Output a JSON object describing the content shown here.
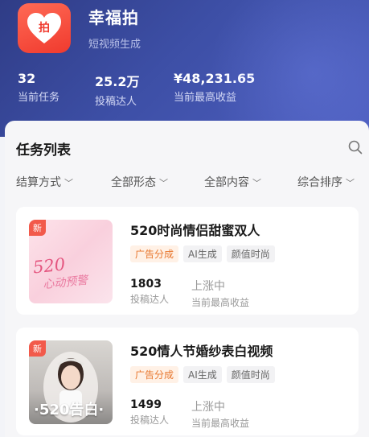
{
  "app": {
    "name": "幸福拍",
    "subtitle": "短视频生成",
    "icon": "heart-icon",
    "icon_text": "拍"
  },
  "stats": [
    {
      "value": "32",
      "label": "当前任务"
    },
    {
      "value": "25.2万",
      "label": "投稿达人"
    },
    {
      "value": "¥48,231.65",
      "label": "当前最高收益"
    }
  ],
  "task_list": {
    "title": "任务列表",
    "search_icon": "search-icon",
    "filters": [
      "结算方式",
      "全部形态",
      "全部内容",
      "综合排序"
    ]
  },
  "cards": [
    {
      "badge": "新",
      "thumb_text": "520",
      "thumb_text_sub": "心动预警",
      "title": "520时尚情侣甜蜜双人",
      "tags": [
        "广告分成",
        "AI生成",
        "颜值时尚"
      ],
      "submitters": "1803",
      "submitters_label": "投稿达人",
      "earning_status": "上涨中",
      "earning_label": "当前最高收益"
    },
    {
      "badge": "新",
      "thumb_text": "·520告白·",
      "title": "520情人节婚纱表白视频",
      "tags": [
        "广告分成",
        "AI生成",
        "颜值时尚"
      ],
      "submitters": "1499",
      "submitters_label": "投稿达人",
      "earning_status": "上涨中",
      "earning_label": "当前最高收益"
    }
  ],
  "colors": {
    "header": "#3d4fa6",
    "accent": "#f25a4b",
    "tag_orange": "#e8772e"
  }
}
